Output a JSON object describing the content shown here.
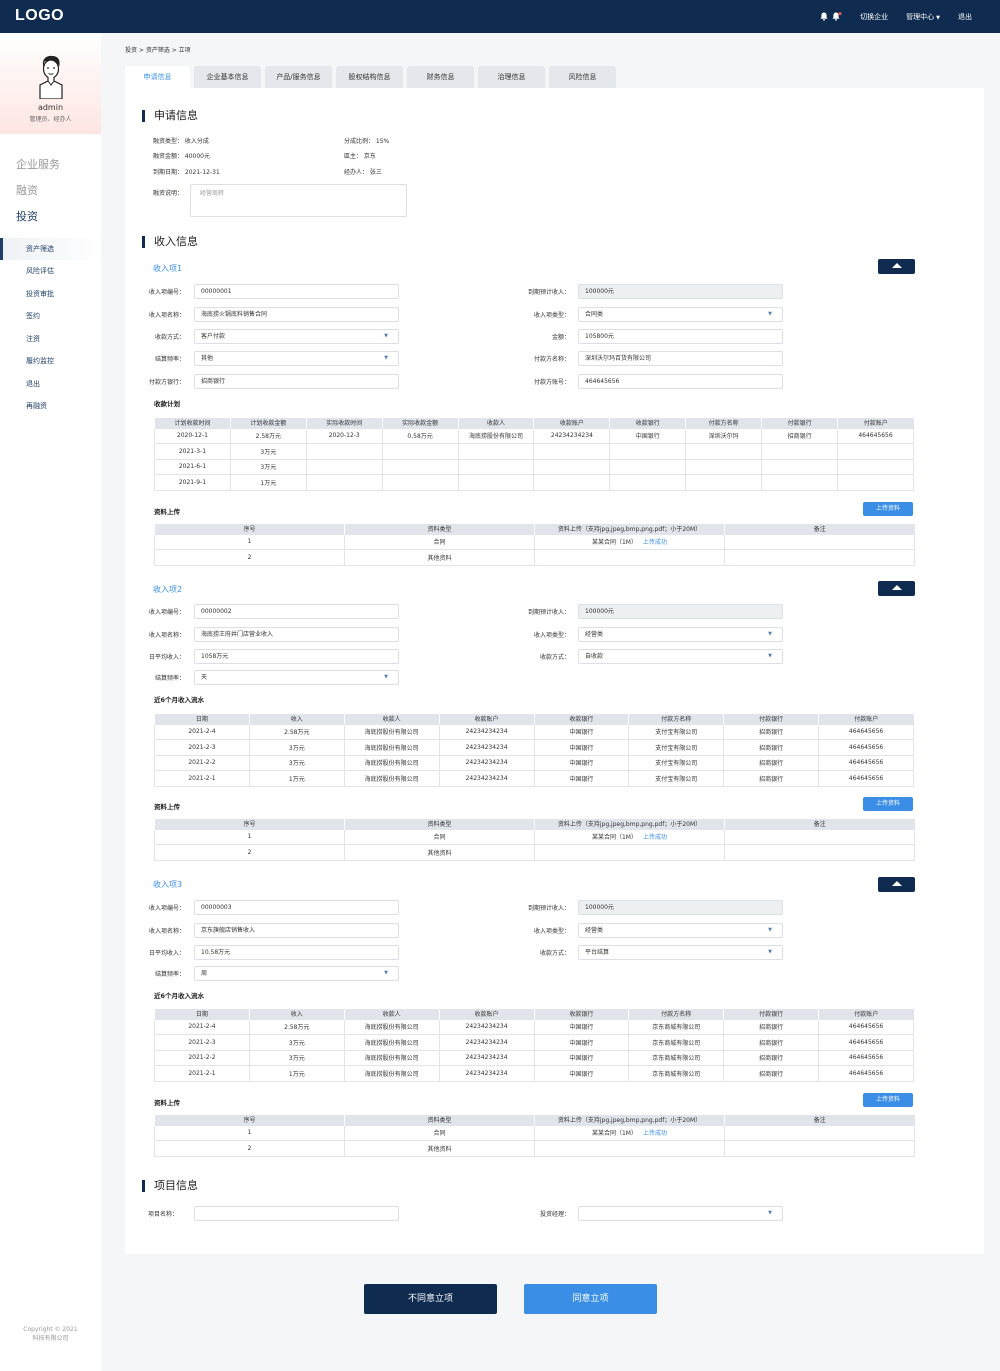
{
  "topbar": {
    "logo": "LOGO",
    "switch": "切换企业",
    "manage": "管理中心",
    "logout": "退出"
  },
  "sidebar": {
    "name": "admin",
    "role": "管理员、经办人",
    "groups": [
      "企业服务",
      "融资",
      "投资"
    ],
    "items": [
      "资产筛选",
      "风险评估",
      "投资审批",
      "签约",
      "注资",
      "履约监控",
      "退出",
      "再融资"
    ],
    "copyright": [
      "Copyright © 2021",
      "科技有限公司"
    ]
  },
  "breadcrumb": "投资 > 资产筛选 > 立项",
  "tabs": [
    "申请信息",
    "企业基本信息",
    "产品/服务信息",
    "股权结构信息",
    "财务信息",
    "治理信息",
    "风险信息"
  ],
  "apply": {
    "title": "申请信息",
    "type": "融资类型：  收入分成",
    "ratio": "分成比例：  15%",
    "amount": "融资金额：  40000元",
    "region": "區主：  京东",
    "due": "到期日期：  2021-12-31",
    "handler": "经办人：  张三",
    "desc_label": "融资说明：",
    "desc_value": "经营周转"
  },
  "income_title": "收入信息",
  "labels": {
    "code": "收入项编号：",
    "expect": "到期预计收入：",
    "name": "收入项名称：",
    "itype": "收入项类型：",
    "collect": "收款方式：",
    "amount": "金额：",
    "freq": "结算频率：",
    "payer": "付款方名称：",
    "payer_bank": "付款方银行：",
    "payer_acct": "付款方账号：",
    "daily": "日平均收入：",
    "plan": "收款计划",
    "upload": "资料上传",
    "flow": "近6个月收入流水",
    "upload_btn": "上传资料"
  },
  "item1": {
    "title": "收入项1",
    "code": "00000001",
    "expect": "100000元",
    "name": "海底捞火锅底料销售合同",
    "itype": "合同类",
    "collect": "客户付款",
    "amount": "105800元",
    "freq": "其他",
    "payer": "深圳沃尔玛百货有限公司",
    "payer_bank": "招商银行",
    "payer_acct": "464645656"
  },
  "plan_headers": [
    "计划收款时间",
    "计划收款金额",
    "实际收款时间",
    "实际收款金额",
    "收款人",
    "收款账户",
    "收款银行",
    "付款方名称",
    "付款银行",
    "付款账户"
  ],
  "plan_rows": [
    [
      "2020-12-1",
      "2.58万元",
      "2020-12-3",
      "0.58万元",
      "海底捞股份有限公司",
      "24234234234",
      "中国银行",
      "深圳沃尔玛",
      "招商银行",
      "464645656"
    ],
    [
      "2021-3-1",
      "3万元",
      "",
      "",
      "",
      "",
      "",
      "",
      "",
      ""
    ],
    [
      "2021-6-1",
      "3万元",
      "",
      "",
      "",
      "",
      "",
      "",
      "",
      ""
    ],
    [
      "2021-9-1",
      "1万元",
      "",
      "",
      "",
      "",
      "",
      "",
      "",
      ""
    ]
  ],
  "upload_headers": [
    "序号",
    "资料类型",
    "资料上传（支持jpg,jpeg,bmp,png,pdf；小于20M）",
    "备注"
  ],
  "upload_rows": [
    [
      "1",
      "合同",
      "某某合同（1M）",
      "上传成功"
    ],
    [
      "2",
      "其他资料",
      "",
      ""
    ]
  ],
  "item2": {
    "title": "收入项2",
    "code": "00000002",
    "expect": "100000元",
    "name": "海底捞王府井门店营业收入",
    "itype": "经营类",
    "daily": "1058万元",
    "collect": "自收款",
    "freq": "天"
  },
  "flow_headers": [
    "日期",
    "收入",
    "收款人",
    "收款账户",
    "收款银行",
    "付款方名称",
    "付款银行",
    "付款账户"
  ],
  "flow2_rows": [
    [
      "2021-2-4",
      "2.58万元",
      "海底捞股份有限公司",
      "24234234234",
      "中国银行",
      "支付宝有限公司",
      "招商银行",
      "464645656"
    ],
    [
      "2021-2-3",
      "3万元",
      "海底捞股份有限公司",
      "24234234234",
      "中国银行",
      "支付宝有限公司",
      "招商银行",
      "464645656"
    ],
    [
      "2021-2-2",
      "3万元",
      "海底捞股份有限公司",
      "24234234234",
      "中国银行",
      "支付宝有限公司",
      "招商银行",
      "464645656"
    ],
    [
      "2021-2-1",
      "1万元",
      "海底捞股份有限公司",
      "24234234234",
      "中国银行",
      "支付宝有限公司",
      "招商银行",
      "464645656"
    ]
  ],
  "item3": {
    "title": "收入项3",
    "code": "00000003",
    "expect": "100000元",
    "name": "京东旗舰店销售收入",
    "itype": "经营类",
    "daily": "10.58万元",
    "collect": "平台结算",
    "freq": "周"
  },
  "flow3_rows": [
    [
      "2021-2-4",
      "2.58万元",
      "海底捞股份有限公司",
      "24234234234",
      "中国银行",
      "京东商城有限公司",
      "招商银行",
      "464645656"
    ],
    [
      "2021-2-3",
      "3万元",
      "海底捞股份有限公司",
      "24234234234",
      "中国银行",
      "京东商城有限公司",
      "招商银行",
      "464645656"
    ],
    [
      "2021-2-2",
      "3万元",
      "海底捞股份有限公司",
      "24234234234",
      "中国银行",
      "京东商城有限公司",
      "招商银行",
      "464645656"
    ],
    [
      "2021-2-1",
      "1万元",
      "海底捞股份有限公司",
      "24234234234",
      "中国银行",
      "京东商城有限公司",
      "招商银行",
      "464645656"
    ]
  ],
  "project": {
    "title": "项目信息",
    "name_label": "项目名称：",
    "manager_label": "投资经理："
  },
  "actions": {
    "reject": "不同意立项",
    "approve": "同意立项"
  },
  "colors": {
    "navy": "#0f2c50",
    "blue": "#3a8ee6"
  }
}
